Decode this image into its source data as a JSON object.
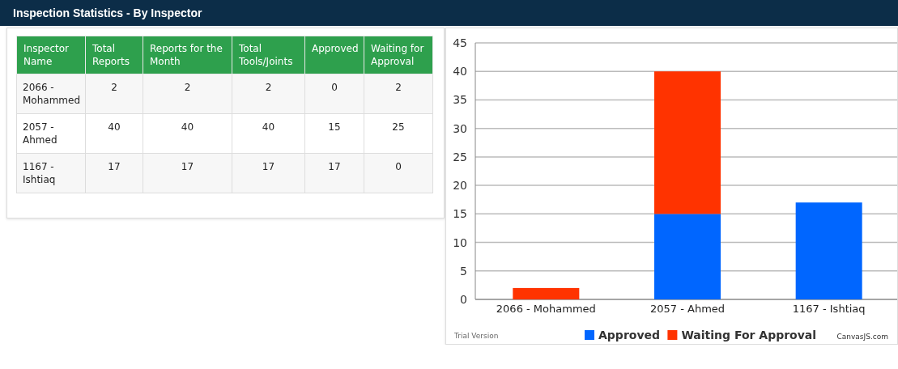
{
  "header": {
    "title": "Inspection Statistics - By Inspector"
  },
  "table": {
    "columns": [
      "Inspector Name",
      "Total Reports",
      "Reports for the Month",
      "Total Tools/Joints",
      "Approved",
      "Waiting for Approval"
    ],
    "rows": [
      [
        "2066 - Mohammed",
        "2",
        "2",
        "2",
        "0",
        "2"
      ],
      [
        "2057 - Ahmed",
        "40",
        "40",
        "40",
        "15",
        "25"
      ],
      [
        "1167 - Ishtiaq",
        "17",
        "17",
        "17",
        "17",
        "0"
      ]
    ]
  },
  "chart": {
    "trial_note": "Trial Version",
    "credit": "CanvasJS.com",
    "chart_data": {
      "type": "bar",
      "stacked": true,
      "categories": [
        "2066 - Mohammed",
        "2057 - Ahmed",
        "1167 - Ishtiaq"
      ],
      "series": [
        {
          "name": "Approved",
          "color": "#0066ff",
          "values": [
            0,
            15,
            17
          ]
        },
        {
          "name": "Waiting For Approval",
          "color": "#ff3300",
          "values": [
            2,
            25,
            0
          ]
        }
      ],
      "grid": true,
      "legend": true,
      "ylim": [
        0,
        45
      ],
      "yticks": [
        0,
        5,
        10,
        15,
        20,
        25,
        30,
        35,
        40,
        45
      ]
    }
  }
}
